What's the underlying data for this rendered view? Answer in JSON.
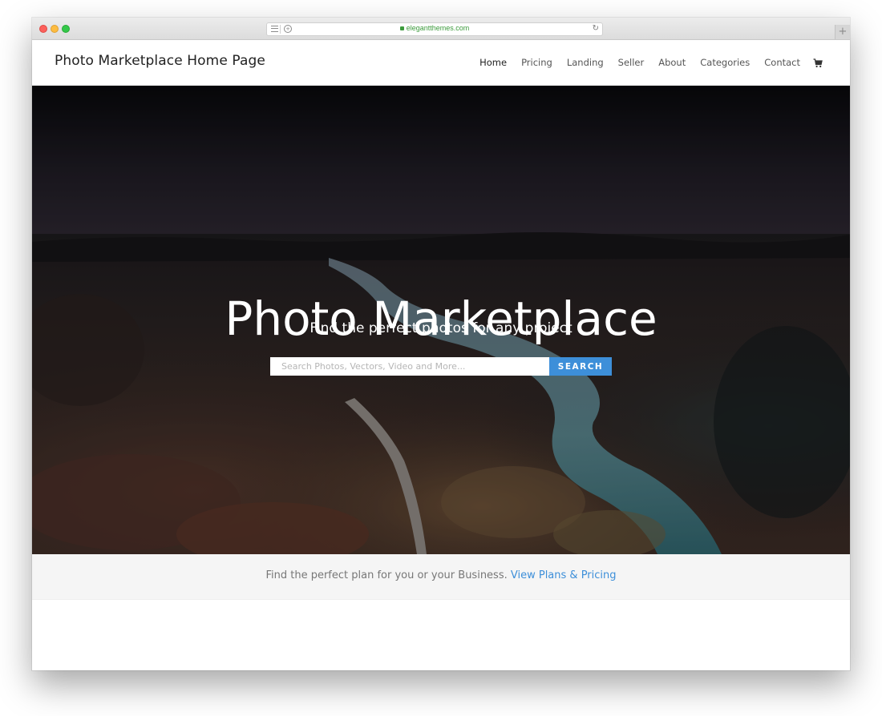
{
  "browser": {
    "url": "elegantthemes.com",
    "new_tab_symbol": "+",
    "reload_symbol": "↻"
  },
  "header": {
    "logo": "Photo Marketplace Home Page",
    "nav": [
      {
        "label": "Home",
        "active": true
      },
      {
        "label": "Pricing",
        "active": false
      },
      {
        "label": "Landing",
        "active": false
      },
      {
        "label": "Seller",
        "active": false
      },
      {
        "label": "About",
        "active": false
      },
      {
        "label": "Categories",
        "active": false
      },
      {
        "label": "Contact",
        "active": false
      }
    ],
    "cart_icon": "shopping-cart-icon"
  },
  "hero": {
    "title": "Photo Marketplace",
    "subtitle": "Find the perfect photos for any project",
    "search": {
      "placeholder": "Search Photos, Vectors, Video and More...",
      "value": "",
      "button_label": "SEARCH"
    }
  },
  "plans": {
    "text": "Find the perfect plan for you or your Business.",
    "link_label": "View Plans & Pricing"
  },
  "colors": {
    "accent": "#3d8fd9",
    "nav_text": "#555555",
    "plans_bg": "#f5f5f5"
  }
}
